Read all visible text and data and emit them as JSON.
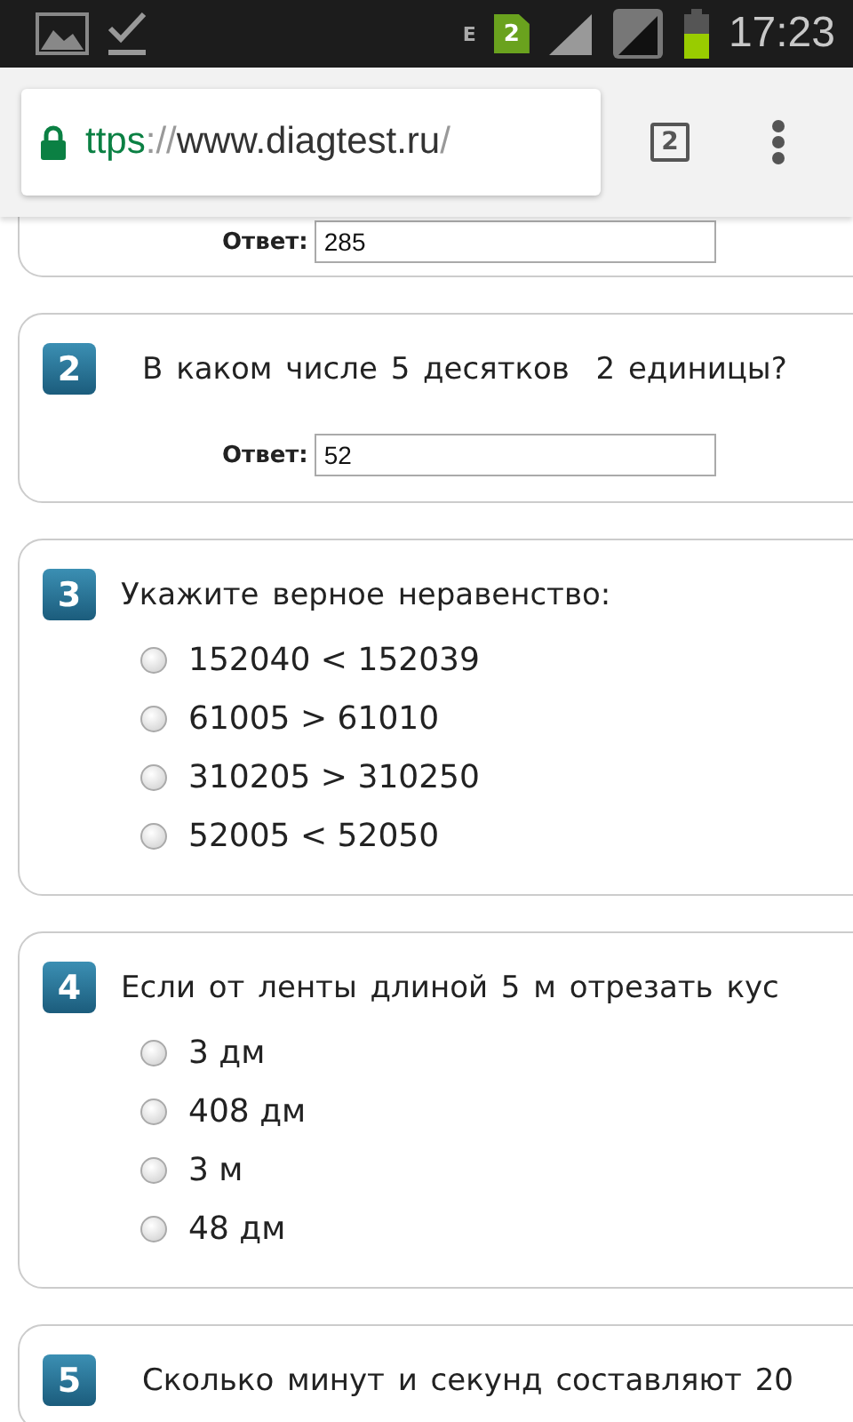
{
  "status_bar": {
    "network": "E",
    "sim": "2",
    "time": "17:23"
  },
  "toolbar": {
    "url": {
      "scheme": "ttps",
      "separator": "://",
      "host": "www.diagtest.ru",
      "path": "/"
    },
    "tab_count": "2"
  },
  "questions": [
    {
      "kind": "answer",
      "answer_label": "Ответ:",
      "answer_value": "285"
    },
    {
      "kind": "answer",
      "number": "2",
      "text": "В каком числе 5 десятков  2 единицы?",
      "answer_label": "Ответ:",
      "answer_value": "52"
    },
    {
      "kind": "choice",
      "number": "3",
      "text": "Укажите верное неравенство:",
      "options": [
        {
          "label": "152040 < 152039",
          "selected": false
        },
        {
          "label": "61005 > 61010",
          "selected": false
        },
        {
          "label": "310205 > 310250",
          "selected": false
        },
        {
          "label": "52005 < 52050",
          "selected": false
        }
      ]
    },
    {
      "kind": "choice",
      "number": "4",
      "text": "Если от ленты длиной 5 м отрезать кус",
      "options": [
        {
          "label": "3 дм",
          "selected": false
        },
        {
          "label": "408 дм",
          "selected": false
        },
        {
          "label": "3 м",
          "selected": false
        },
        {
          "label": "48 дм",
          "selected": false
        }
      ]
    },
    {
      "kind": "title",
      "number": "5",
      "text": "Сколько минут и секунд составляют 20"
    }
  ]
}
